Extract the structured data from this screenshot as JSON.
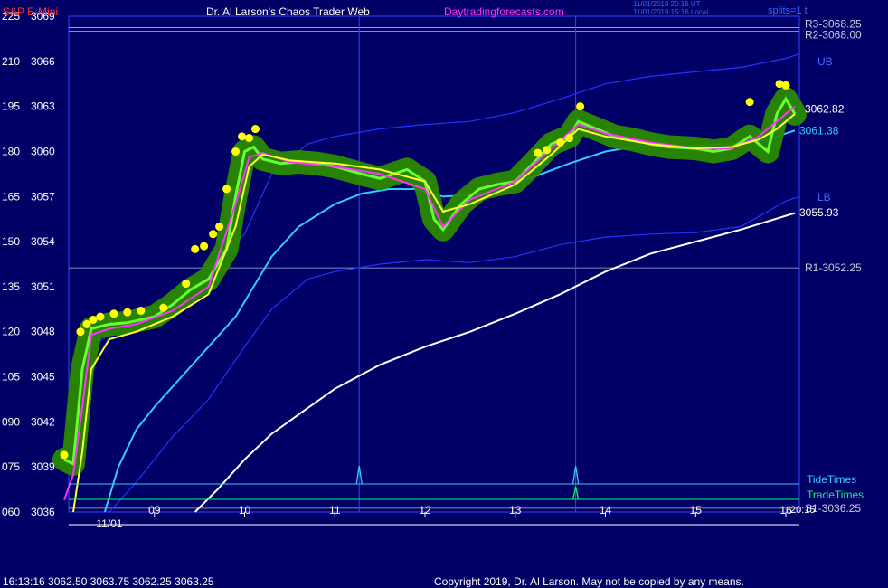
{
  "header": {
    "symbol": "S&P E-Mini",
    "title": "Dr. Al Larson's Chaos Trader Web",
    "site": "Daytradingforecasts.com",
    "utc_time": "11/01/2019 20:16 UT",
    "local_time": "11/01/2019 15:16 Local",
    "splits": "splits=1 t"
  },
  "footer": {
    "quote": "16:13:16  3062.50 3063.75 3062.25 3063.25",
    "copyright": "Copyright 2019, Dr. Al Larson. May not be copied by any means."
  },
  "colors": {
    "background": "#000066",
    "price": "#66ff33",
    "fast_avg": "#ff33ff",
    "mid_avg": "#ffff33",
    "slow_avg": "#33ccff",
    "long_avg": "#ffffff",
    "band": "#2233ff",
    "tide": "#33ccff",
    "trade": "#00ff66",
    "label_red": "#ff3333",
    "label_white": "#ffffff",
    "label_magenta": "#ff33ff"
  },
  "chart_data": {
    "type": "line",
    "title": "S&P E-Mini",
    "ylim": [
      3036,
      3069
    ],
    "xlim": [
      8.05,
      16.15
    ],
    "y_ticks": [
      {
        "left": "225",
        "right": "3069"
      },
      {
        "left": "210",
        "right": "3066"
      },
      {
        "left": "195",
        "right": "3063"
      },
      {
        "left": "180",
        "right": "3060"
      },
      {
        "left": "165",
        "right": "3057"
      },
      {
        "left": "150",
        "right": "3054"
      },
      {
        "left": "135",
        "right": "3051"
      },
      {
        "left": "120",
        "right": "3048"
      },
      {
        "left": "105",
        "right": "3045"
      },
      {
        "left": "090",
        "right": "3042"
      },
      {
        "left": "075",
        "right": "3039"
      },
      {
        "left": "060",
        "right": "3036"
      }
    ],
    "x_ticks": [
      "09",
      "10",
      "11",
      "12",
      "13",
      "14",
      "15",
      "16"
    ],
    "date_label": "11/01",
    "h_levels": [
      {
        "label": "R3-3068.25",
        "value": 3068.25
      },
      {
        "label": "R2-3068.00",
        "value": 3068.0
      },
      {
        "label": "R1-3052.25",
        "value": 3052.25
      },
      {
        "label": "S1-3036.25",
        "value": 3036.25
      }
    ],
    "v_markers": [
      11.27,
      13.67
    ],
    "band_labels": {
      "upper": "UB",
      "lower": "LB"
    },
    "value_labels": {
      "price": "3062.82",
      "slow_avg": "3061.38",
      "long_avg": "3055.93"
    },
    "timing_lines": {
      "tide": "TideTimes",
      "trade": "TradeTimes",
      "extra": "20:15"
    },
    "price_series": {
      "x": [
        8.0,
        8.1,
        8.2,
        8.3,
        8.5,
        8.7,
        9.0,
        9.2,
        9.4,
        9.6,
        9.8,
        9.9,
        10.0,
        10.1,
        10.2,
        10.4,
        10.6,
        10.8,
        11.0,
        11.3,
        11.5,
        11.8,
        12.0,
        12.1,
        12.2,
        12.4,
        12.6,
        12.8,
        13.0,
        13.2,
        13.4,
        13.6,
        13.7,
        13.9,
        14.1,
        14.3,
        14.5,
        14.7,
        15.0,
        15.2,
        15.4,
        15.6,
        15.7,
        15.8,
        15.9,
        16.0,
        16.1
      ],
      "y": [
        3039.5,
        3039.2,
        3045.5,
        3048.2,
        3048.5,
        3048.6,
        3049.0,
        3049.8,
        3050.8,
        3051.5,
        3053.5,
        3057.0,
        3060.0,
        3060.3,
        3059.5,
        3059.2,
        3059.3,
        3059.2,
        3059.0,
        3058.5,
        3058.2,
        3058.8,
        3058.0,
        3055.5,
        3054.8,
        3056.5,
        3057.5,
        3057.8,
        3058.0,
        3059.2,
        3060.5,
        3061.0,
        3062.0,
        3061.5,
        3061.0,
        3060.8,
        3060.5,
        3060.3,
        3060.2,
        3060.0,
        3060.2,
        3061.0,
        3060.5,
        3060.0,
        3062.5,
        3063.5,
        3062.5
      ]
    },
    "mid_avg": {
      "x": [
        8.1,
        8.2,
        8.3,
        8.5,
        8.8,
        9.2,
        9.6,
        9.9,
        10.05,
        10.2,
        10.5,
        11.0,
        11.5,
        12.0,
        12.2,
        12.5,
        13.0,
        13.4,
        13.7,
        14.0,
        14.5,
        15.0,
        15.4,
        15.7,
        15.9,
        16.1
      ],
      "y": [
        3036.0,
        3040.0,
        3045.5,
        3047.5,
        3048.0,
        3049.0,
        3050.5,
        3055.0,
        3059.0,
        3059.8,
        3059.4,
        3059.2,
        3058.8,
        3058.0,
        3056.0,
        3056.5,
        3057.8,
        3059.8,
        3061.5,
        3061.0,
        3060.5,
        3060.2,
        3060.3,
        3060.8,
        3061.5,
        3062.5
      ]
    },
    "fast_avg": {
      "x": [
        8.0,
        8.1,
        8.2,
        8.3,
        8.5,
        8.8,
        9.2,
        9.6,
        9.9,
        10.05,
        10.2,
        10.5,
        11.0,
        11.5,
        12.0,
        12.2,
        12.5,
        13.0,
        13.4,
        13.7,
        14.0,
        14.5,
        15.0,
        15.4,
        15.7,
        15.9,
        16.1
      ],
      "y": [
        3036.8,
        3038.5,
        3043.0,
        3047.8,
        3048.2,
        3048.5,
        3049.4,
        3051.0,
        3056.5,
        3059.6,
        3059.9,
        3059.3,
        3059.0,
        3058.5,
        3057.5,
        3055.0,
        3056.8,
        3058.0,
        3060.2,
        3061.8,
        3061.2,
        3060.6,
        3060.2,
        3060.2,
        3061.0,
        3062.0,
        3063.0
      ]
    },
    "slow_avg": {
      "x": [
        8.45,
        8.6,
        8.8,
        9.0,
        9.3,
        9.6,
        9.9,
        10.1,
        10.3,
        10.6,
        11.0,
        11.3,
        11.6,
        11.9,
        12.2,
        12.5,
        12.8,
        13.2,
        13.6,
        14.0,
        14.3,
        14.7,
        15.0,
        15.4,
        15.8,
        16.1
      ],
      "y": [
        3036.0,
        3039.0,
        3041.5,
        3043.0,
        3045.0,
        3047.0,
        3049.0,
        3051.0,
        3053.0,
        3055.0,
        3056.5,
        3057.2,
        3057.5,
        3057.5,
        3057.0,
        3057.1,
        3057.5,
        3058.3,
        3059.2,
        3060.0,
        3060.3,
        3060.4,
        3060.4,
        3060.5,
        3060.8,
        3061.4
      ]
    },
    "long_avg": {
      "x": [
        9.45,
        9.7,
        10.0,
        10.3,
        10.6,
        11.0,
        11.5,
        12.0,
        12.5,
        13.0,
        13.5,
        14.0,
        14.5,
        15.0,
        15.5,
        16.1
      ],
      "y": [
        3036.0,
        3037.5,
        3039.5,
        3041.2,
        3042.5,
        3044.2,
        3045.8,
        3047.0,
        3048.0,
        3049.2,
        3050.5,
        3052.0,
        3053.2,
        3054.0,
        3054.8,
        3055.9
      ]
    },
    "upper_band": {
      "x": [
        8.1,
        8.3,
        8.6,
        9.0,
        9.5,
        10.0,
        10.3,
        10.7,
        11.0,
        11.5,
        12.0,
        12.5,
        13.0,
        13.5,
        14.0,
        14.5,
        15.0,
        15.5,
        16.0,
        16.15
      ],
      "y": [
        3045.5,
        3047.0,
        3048.2,
        3049.5,
        3051.5,
        3054.5,
        3058.5,
        3060.5,
        3061.0,
        3061.5,
        3061.8,
        3062.0,
        3062.6,
        3063.5,
        3064.5,
        3065.0,
        3065.3,
        3065.6,
        3066.2,
        3066.5
      ]
    },
    "lower_band": {
      "x": [
        8.5,
        8.8,
        9.2,
        9.6,
        10.0,
        10.3,
        10.7,
        11.0,
        11.5,
        12.0,
        12.5,
        13.0,
        13.5,
        14.0,
        14.5,
        15.0,
        15.5,
        16.0,
        16.15
      ],
      "y": [
        3036.0,
        3038.0,
        3041.0,
        3043.5,
        3047.0,
        3049.5,
        3051.5,
        3052.0,
        3052.5,
        3052.8,
        3052.6,
        3053.0,
        3053.8,
        3054.3,
        3054.5,
        3054.6,
        3055.0,
        3056.7,
        3057.0
      ]
    },
    "highlight_points": {
      "x": [
        8.0,
        8.18,
        8.25,
        8.32,
        8.4,
        8.55,
        8.7,
        8.85,
        9.1,
        9.35,
        9.45,
        9.55,
        9.65,
        9.72,
        9.8,
        9.9,
        9.97,
        10.05,
        10.12,
        13.25,
        13.35,
        13.5,
        13.6,
        13.72,
        15.6,
        15.93,
        16.0
      ],
      "y": [
        3039.8,
        3048.0,
        3048.5,
        3048.8,
        3049.0,
        3049.2,
        3049.3,
        3049.4,
        3049.6,
        3051.2,
        3053.5,
        3053.7,
        3054.5,
        3055.0,
        3057.5,
        3060.0,
        3061.0,
        3060.9,
        3061.5,
        3059.9,
        3060.1,
        3060.6,
        3060.9,
        3063.0,
        3063.3,
        3064.5,
        3064.4
      ]
    }
  }
}
